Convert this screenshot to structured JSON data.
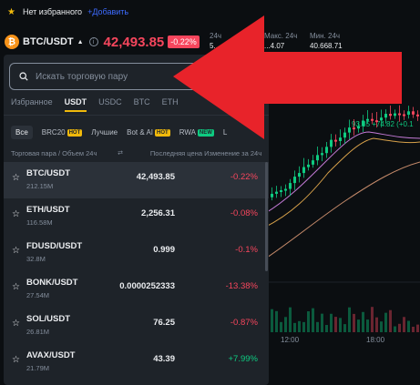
{
  "favorites_bar": {
    "no_favorites": "Нет избранного",
    "add_label": "+Добавить"
  },
  "header": {
    "pair": "BTC/USDT",
    "price": "42,493.85",
    "change_badge": "-0.22%",
    "stat_labels": [
      "24ч",
      "Макс. 24ч",
      "Мин. 24ч"
    ],
    "stat_values": [
      "5...",
      "...4.07",
      "40.668.71"
    ]
  },
  "panel": {
    "search_placeholder": "Искать торговую пару",
    "tabs": [
      "Избранное",
      "USDT",
      "USDC",
      "BTC",
      "ETH"
    ],
    "active_tab": "USDT",
    "chips": [
      {
        "label": "Все",
        "badge": ""
      },
      {
        "label": "BRC20",
        "badge": "HOT"
      },
      {
        "label": "Лучшие",
        "badge": ""
      },
      {
        "label": "Bot & AI",
        "badge": "HOT"
      },
      {
        "label": "RWA",
        "badge": "NEW"
      },
      {
        "label": "L",
        "badge": ""
      }
    ],
    "columns": {
      "pair_volume": "Торговая пара / Объем 24ч",
      "last_price": "Последняя цена",
      "change": "Изменение за 24ч"
    },
    "rows": [
      {
        "symbol": "BTC/USDT",
        "volume": "212.15M",
        "last": "42,493.85",
        "change": "-0.22%",
        "dir": "neg"
      },
      {
        "symbol": "ETH/USDT",
        "volume": "116.58M",
        "last": "2,256.31",
        "change": "-0.08%",
        "dir": "neg"
      },
      {
        "symbol": "FDUSD/USDT",
        "volume": "32.8M",
        "last": "0.999",
        "change": "-0.1%",
        "dir": "neg"
      },
      {
        "symbol": "BONK/USDT",
        "volume": "27.54M",
        "last": "0.0000252333",
        "change": "-13.38%",
        "dir": "neg"
      },
      {
        "symbol": "SOL/USDT",
        "volume": "26.81M",
        "last": "76.25",
        "change": "-0.87%",
        "dir": "neg"
      },
      {
        "symbol": "AVAX/USDT",
        "volume": "21.79M",
        "last": "43.39",
        "change": "+7.99%",
        "dir": "pos"
      }
    ]
  },
  "chart": {
    "price_label": "93.85 +74.82 (+0.1",
    "time_labels": [
      "12:00",
      "18:00"
    ]
  },
  "colors": {
    "accent": "#f0b90b",
    "negative": "#f6465d",
    "positive": "#0ecb81",
    "annotation_arrow": "#e8232a"
  }
}
